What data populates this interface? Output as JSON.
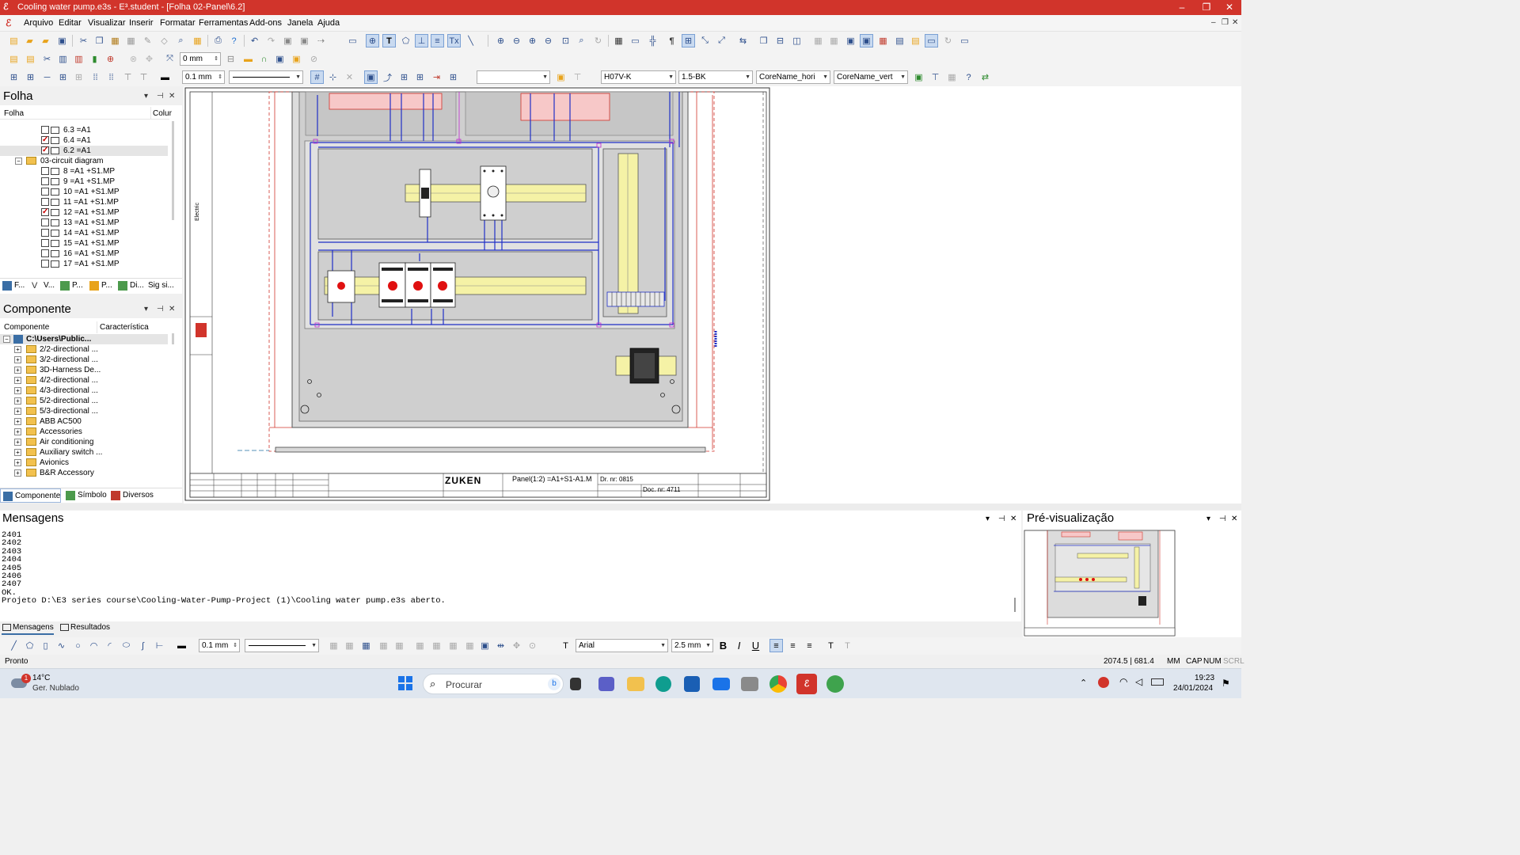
{
  "title": "Cooling water pump.e3s - E³.student - [Folha 02-Panel\\6.2]",
  "window_controls": {
    "minimize": "–",
    "restore": "❐",
    "close": "✕"
  },
  "mdi_controls": {
    "minimize": "–",
    "restore": "❐",
    "close": "✕"
  },
  "menu": [
    "Arquivo",
    "Editar",
    "Visualizar",
    "Inserir",
    "Formatar",
    "Ferramentas",
    "Add-ons",
    "Janela",
    "Ajuda"
  ],
  "toolbar": {
    "offset_value": "0 mm",
    "line_width": "0.1 mm",
    "wire_type": "H07V-K",
    "wire_color": "1.5-BK",
    "core_name_h": "CoreName_hori",
    "core_name_v": "CoreName_vert",
    "blank_select": ""
  },
  "folha_panel": {
    "title": "Folha",
    "col1": "Folha",
    "col2": "Colur",
    "items": [
      {
        "label": "6.3 =A1",
        "checked": false,
        "indent": 1
      },
      {
        "label": "6.4 =A1",
        "checked": true,
        "indent": 1
      },
      {
        "label": "6.2 =A1",
        "checked": true,
        "indent": 1,
        "selected": true
      },
      {
        "label": "03-circuit diagram",
        "folder": true,
        "indent": 0
      },
      {
        "label": "8 =A1 +S1.MP",
        "checked": false,
        "indent": 1
      },
      {
        "label": "9 =A1 +S1.MP",
        "checked": false,
        "indent": 1
      },
      {
        "label": "10 =A1 +S1.MP",
        "checked": false,
        "indent": 1
      },
      {
        "label": "11 =A1 +S1.MP",
        "checked": false,
        "indent": 1
      },
      {
        "label": "12 =A1 +S1.MP",
        "checked": true,
        "indent": 1
      },
      {
        "label": "13 =A1 +S1.MP",
        "checked": false,
        "indent": 1
      },
      {
        "label": "14 =A1 +S1.MP",
        "checked": false,
        "indent": 1
      },
      {
        "label": "15 =A1 +S1.MP",
        "checked": false,
        "indent": 1
      },
      {
        "label": "16 =A1 +S1.MP",
        "checked": false,
        "indent": 1
      },
      {
        "label": "17 =A1 +S1.MP",
        "checked": false,
        "indent": 1
      }
    ],
    "tabs": [
      "F...",
      "V...",
      "P...",
      "P...",
      "Di...",
      "Sig si..."
    ]
  },
  "comp_panel": {
    "title": "Componente",
    "col1": "Componente",
    "col2": "Característica",
    "root": "C:\\Users\\Public...",
    "items": [
      "2/2-directional ...",
      "3/2-directional ...",
      "3D-Harness De...",
      "4/2-directional ...",
      "4/3-directional ...",
      "5/2-directional ...",
      "5/3-directional ...",
      "ABB AC500",
      "Accessories",
      "Air conditioning",
      "Auxiliary switch ...",
      "Avionics",
      "B&R Accessory"
    ],
    "tabs": [
      "Componente",
      "Símbolo",
      "Diversos"
    ]
  },
  "drawing": {
    "brand": "ZUKEN",
    "panel_label": "Panel(1:2) =A1+S1-A1.M",
    "drawing_no": "Dr. nr: 0815",
    "doc_no": "Doc. nr: 4711",
    "side_text": "Electric"
  },
  "messages": {
    "title": "Mensagens",
    "lines": [
      "2401",
      "2402",
      "2403",
      "2404",
      "2405",
      "2406",
      "2407",
      "OK.",
      "Projeto D:\\E3 series course\\Cooling-Water-Pump-Project (1)\\Cooling water pump.e3s aberto."
    ],
    "tabs": [
      "Mensagens",
      "Resultados"
    ]
  },
  "preview": {
    "title": "Pré-visualização"
  },
  "bottom_toolbar": {
    "line_width": "0.1 mm",
    "font": "Arial",
    "font_size": "2.5 mm",
    "bold": "B",
    "italic": "I",
    "underline": "U"
  },
  "status": {
    "text": "Pronto",
    "coords": "2074.5 | 681.4",
    "unit": "MM",
    "caps": "CAP",
    "num": "NUM",
    "scrl": "SCRL"
  },
  "taskbar": {
    "temp": "14°C",
    "weather": "Ger. Nublado",
    "badge": "1",
    "search": "Procurar",
    "time": "19:23",
    "date": "24/01/2024"
  }
}
